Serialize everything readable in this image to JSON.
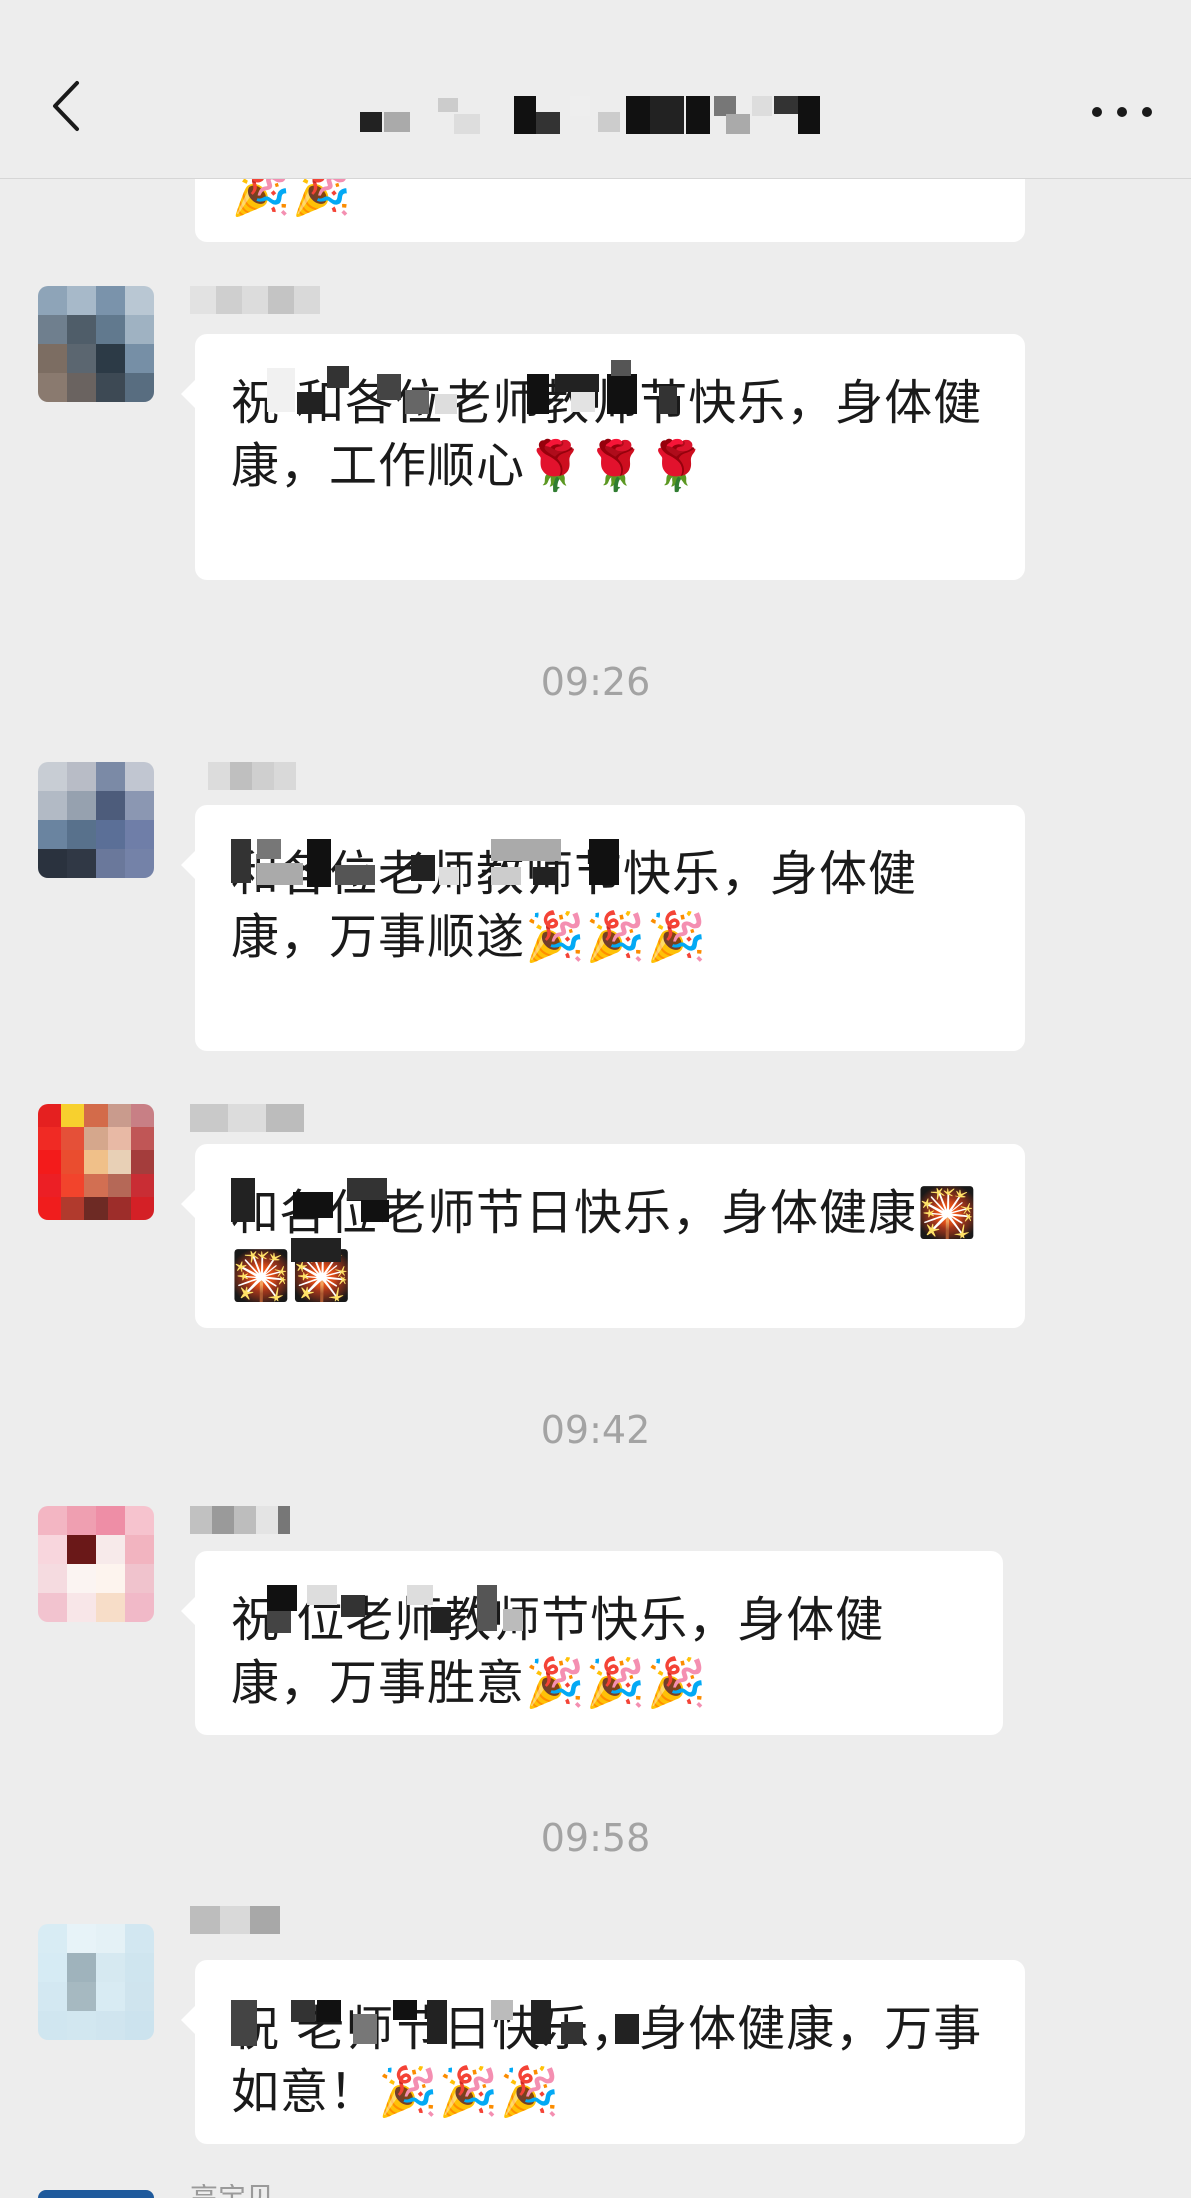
{
  "header": {
    "back_icon": "chevron-left-icon",
    "title": "",
    "more_icon": "more-icon"
  },
  "messages": [
    {
      "text": "🎉🎉"
    },
    {
      "text": "祝                         和各位老师教师节快乐，身体健康，工作顺心🌹🌹🌹"
    },
    {
      "text": "                                   和各位老师教师节快乐，身体健康，万事顺遂🎉🎉🎉"
    },
    {
      "text": "                     和各位老师节日快乐，身体健康🎇🎇🎇"
    },
    {
      "text": "祝                        位老师教师节快乐，身体健康，万事胜意🎉🎉🎉"
    },
    {
      "text": "祝                                 老师节日快乐，身体健康，万事如意！🎉🎉🎉"
    }
  ],
  "times": [
    "09:26",
    "09:42",
    "09:58"
  ],
  "bottom_name": "高宝贝",
  "colors": {
    "background": "#ededed",
    "bubble": "#ffffff",
    "text": "#1a1a1a",
    "timestamp": "#a3a3a3"
  }
}
